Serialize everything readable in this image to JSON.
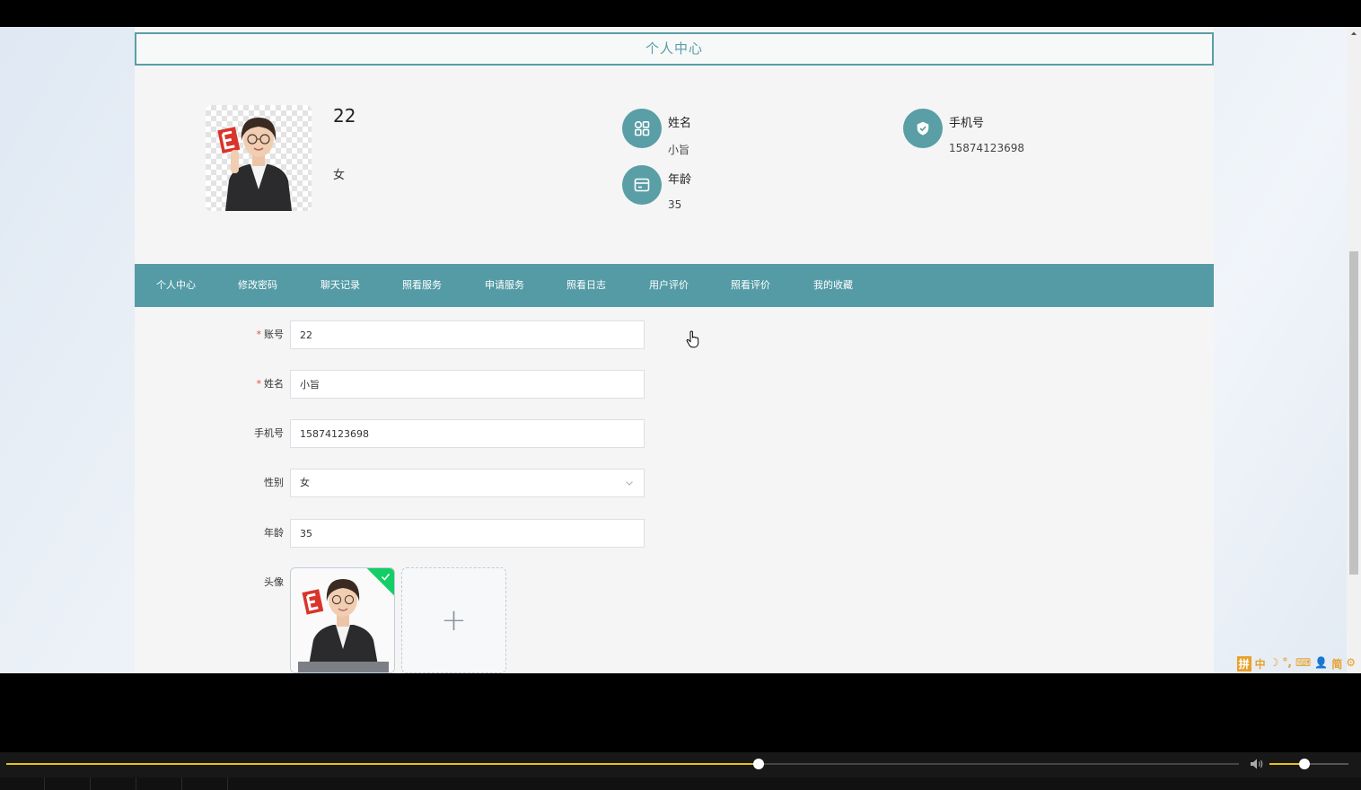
{
  "page": {
    "title": "个人中心"
  },
  "profile": {
    "username": "22",
    "gender": "女",
    "fields": [
      {
        "label": "姓名",
        "value": "小旨"
      },
      {
        "label": "年龄",
        "value": "35"
      },
      {
        "label": "手机号",
        "value": "15874123698"
      }
    ]
  },
  "nav": {
    "items": [
      {
        "label": "个人中心"
      },
      {
        "label": "修改密码"
      },
      {
        "label": "聊天记录"
      },
      {
        "label": "照看服务"
      },
      {
        "label": "申请服务"
      },
      {
        "label": "照看日志"
      },
      {
        "label": "用户评价"
      },
      {
        "label": "照看评价"
      },
      {
        "label": "我的收藏"
      }
    ]
  },
  "form": {
    "account": {
      "label": "账号",
      "value": "22",
      "required": true
    },
    "name": {
      "label": "姓名",
      "value": "小旨",
      "required": true
    },
    "phone": {
      "label": "手机号",
      "value": "15874123698"
    },
    "gender": {
      "label": "性别",
      "value": "女"
    },
    "age": {
      "label": "年龄",
      "value": "35"
    },
    "avatar": {
      "label": "头像",
      "add_symbol": "+"
    }
  },
  "colors": {
    "accent": "#549ba5",
    "required": "#e74c3c",
    "progress": "#e6c21a",
    "upload_success": "#13ce66"
  },
  "ime": {
    "items": [
      "拼",
      "中",
      "☽",
      "°,",
      "⌨",
      "👤",
      "简",
      "⚙"
    ]
  },
  "player": {
    "progress": 0.61,
    "volume": 0.44
  },
  "icons": [
    "apps-icon",
    "wallet-icon",
    "shield-check-icon",
    "chevron-down-icon",
    "plus-icon",
    "volume-icon",
    "hand-cursor-icon"
  ]
}
